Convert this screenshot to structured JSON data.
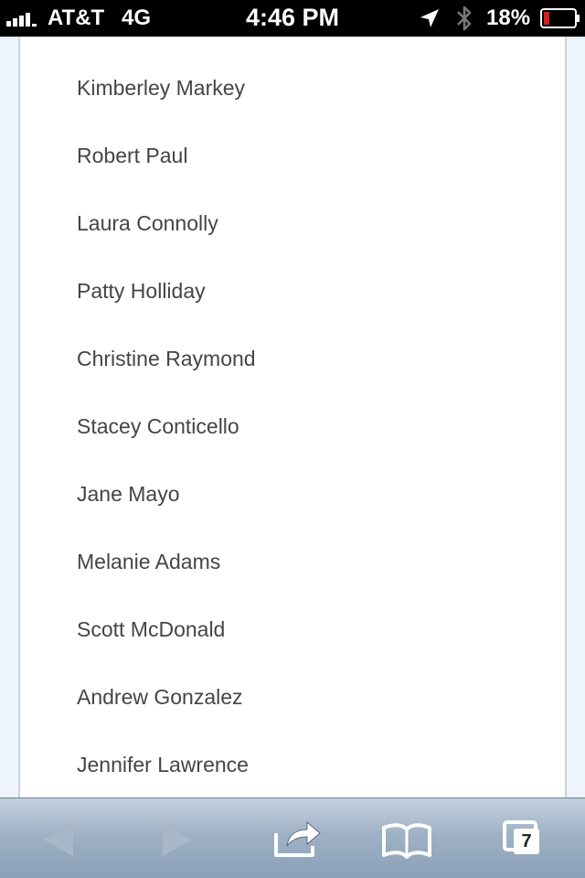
{
  "status_bar": {
    "carrier": "AT&T",
    "network": "4G",
    "time": "4:46 PM",
    "battery_percent": "18%",
    "signal_bars": 4,
    "battery_level": 0.18,
    "icons": [
      "signal-icon",
      "location-arrow-icon",
      "bluetooth-icon",
      "battery-icon"
    ]
  },
  "names": [
    "Kimberley Markey",
    "Robert Paul",
    "Laura Connolly",
    "Patty Holliday",
    "Christine Raymond",
    "Stacey Conticello",
    "Jane Mayo",
    "Melanie Adams",
    "Scott McDonald",
    "Andrew Gonzalez",
    "Jennifer Lawrence"
  ],
  "toolbar": {
    "buttons": [
      "back-arrow-icon",
      "forward-arrow-icon",
      "share-icon",
      "bookmarks-icon",
      "tabs-icon"
    ],
    "tab_count": "7"
  },
  "colors": {
    "status_bar_bg": "#000000",
    "page_bg": "#eef4fb",
    "text": "#454545",
    "toolbar_top": "#c6d1de",
    "toolbar_bottom": "#8aa0b8"
  }
}
